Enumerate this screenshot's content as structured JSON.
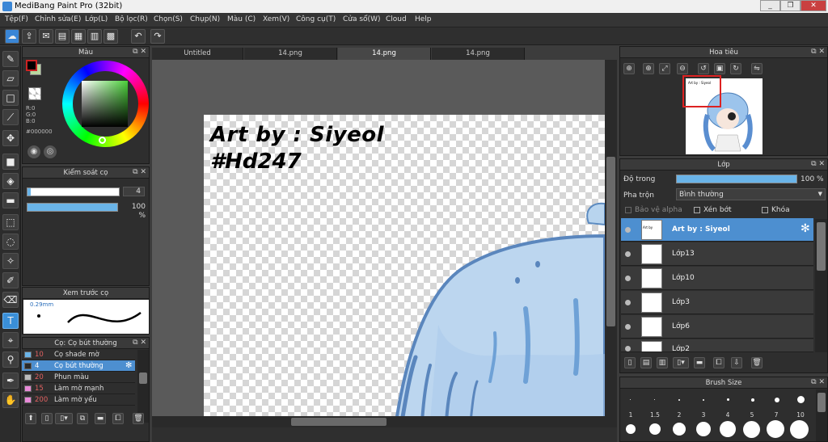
{
  "title": "MediBang Paint Pro (32bit)",
  "window_buttons": {
    "minimize": "_",
    "restore": "❐",
    "close": "✕"
  },
  "menu": [
    "Tệp(F)",
    "Chỉnh sửa(E)",
    "Lớp(L)",
    "Bộ lọc(R)",
    "Chọn(S)",
    "Chụp(N)",
    "Màu (C)",
    "Xem(V)",
    "Công cụ(T)",
    "Cửa sổ(W)",
    "Cloud",
    "Help"
  ],
  "tabs": [
    "Untitled",
    "14.png",
    "14.png",
    "14.png"
  ],
  "active_tab": 2,
  "color_panel": {
    "title": "Màu",
    "r": "R:0",
    "g": "G:0",
    "b": "B:0",
    "hex": "#000000",
    "foreground": "#000000",
    "background": "#ffffff",
    "secondary": "#b8d8a0"
  },
  "brush_control": {
    "title": "Kiểm soát cọ",
    "size_value": "4",
    "opacity_value": "100 %"
  },
  "preview": {
    "title": "Xem trước cọ",
    "size_label": "0.29mm"
  },
  "brush_list": {
    "title": "Cọ: Cọ bút thường",
    "items": [
      {
        "num": "10",
        "name": "Cọ shade mờ",
        "color": "#6ab4e8"
      },
      {
        "num": "4",
        "name": "Cọ bút thường",
        "color": "#2a2a2a"
      },
      {
        "num": "20",
        "name": "Phun màu",
        "color": "#bbbbbb"
      },
      {
        "num": "15",
        "name": "Làm mờ mạnh",
        "color": "#e88ad8"
      },
      {
        "num": "200",
        "name": "Làm mờ yếu",
        "color": "#e88ad8"
      }
    ],
    "selected": 1
  },
  "canvas": {
    "line1": "Art by : Siyeol",
    "line2": "#Hd247"
  },
  "navigator": {
    "title": "Hoa tiêu"
  },
  "layer_panel": {
    "title": "Lớp",
    "opacity_label": "Độ trong",
    "opacity_value": "100 %",
    "blend_label": "Pha trộn",
    "blend_value": "Bình thường",
    "protect_alpha": "Bảo vệ alpha",
    "clipping": "Xén bớt",
    "lock": "Khóa",
    "layers": [
      "Art by : Siyeol",
      "Lớp13",
      "Lớp10",
      "Lớp3",
      "Lớp6",
      "Lớp2"
    ],
    "selected": 0
  },
  "brush_size": {
    "title": "Brush Size",
    "labels": [
      "1",
      "1.5",
      "2",
      "3",
      "4",
      "5",
      "7",
      "10"
    ]
  },
  "icons": [
    "undo-icon",
    "redo-icon",
    "brush-icon",
    "eraser-icon",
    "gear-icon",
    "eye-icon",
    "trash-icon",
    "folder-icon",
    "zoom-in-icon",
    "zoom-out-icon"
  ]
}
